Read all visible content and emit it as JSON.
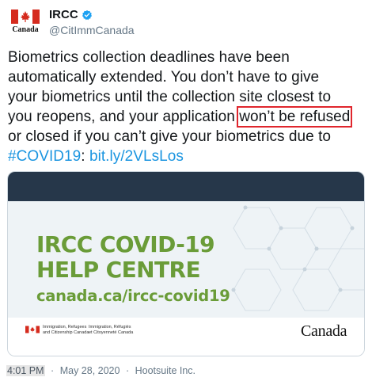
{
  "account": {
    "display_name": "IRCC",
    "handle": "@CitImmCanada",
    "avatar_wordmark": "Canada",
    "verified_icon": "verified-badge-icon",
    "avatar_icon": "canada-flag-icon"
  },
  "tweet": {
    "line1": "Biometrics collection deadlines have been",
    "line2": "automatically extended. You don’t have to give",
    "line3": "your biometrics until the collection site closest to",
    "line4_pre": "you reopens, and your application ",
    "line4_highlight": "won’t be refused",
    "line5": "or closed if you can’t give your biometrics due to",
    "hashtag": "#COVID19",
    "colon": ": ",
    "link": "bit.ly/2VLsLos"
  },
  "card": {
    "title_line1": "IRCC COVID-19",
    "title_line2": "HELP CENTRE",
    "url": "canada.ca/ircc-covid19",
    "dept_en_line1": "Immigration, Refugees",
    "dept_en_line2": "and Citizenship Canada",
    "dept_fr_line1": "Immigration, Réfugiés",
    "dept_fr_line2": "et Citoyenneté Canada",
    "wordmark": "Canada"
  },
  "meta": {
    "time": "4:01 PM",
    "date": "May 28, 2020",
    "separator": "·",
    "source": "Hootsuite Inc."
  },
  "colors": {
    "link": "#1b95e0",
    "highlight_border": "#e0262d",
    "card_banner": "#26374a",
    "card_green": "#6a9c38",
    "flag_red": "#d52b1e"
  }
}
